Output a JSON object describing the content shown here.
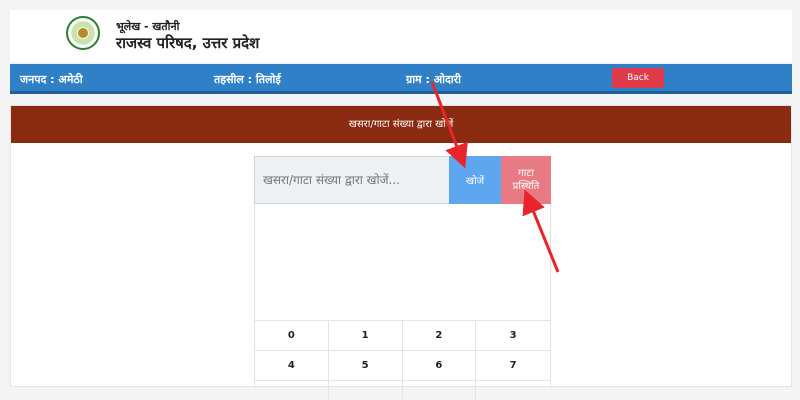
{
  "header": {
    "brand_line1": "भूलेख - खतौनी",
    "brand_line2": "राजस्व परिषद, उत्तर प्रदेश",
    "logo_icon": "emblem-icon"
  },
  "info_bar": {
    "district": "जनपद : अमेठी",
    "tehsil": "तहसील : तिलोई",
    "village": "ग्राम : ओदारी",
    "back_label": "Back"
  },
  "search_card": {
    "title": "खसरा/गाटा संख्या द्वारा खोजें",
    "input_placeholder": "खसरा/गाटा संख्या द्वारा खोजें...",
    "input_value": "",
    "search_button": "खोजें",
    "map_button": "गाटा प्रस्थिति"
  },
  "number_pad": [
    "0",
    "1",
    "2",
    "3",
    "4",
    "5",
    "6",
    "7",
    "",
    "",
    "",
    ""
  ],
  "colors": {
    "info_bar": "#2f80c6",
    "card_header": "#8a2a10",
    "back_button": "#e03b4a",
    "search_button": "#5fa6f0",
    "map_button": "#e87a83",
    "annotation_arrow": "#e8252a"
  }
}
